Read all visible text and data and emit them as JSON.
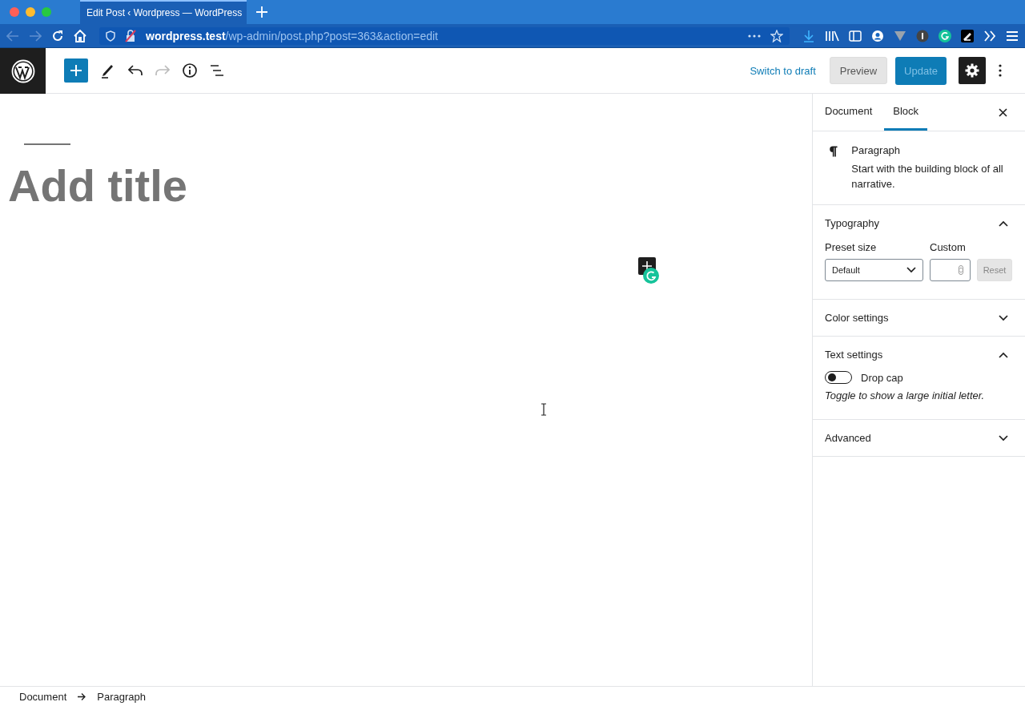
{
  "browser": {
    "tab": {
      "title": "Edit Post ‹ Wordpress — WordPress",
      "selected": true
    },
    "url_host": "wordpress.test",
    "url_path": "/wp-admin/post.php?post=363&action=edit"
  },
  "toolbar": {
    "tools": [
      {
        "kind": "inserter",
        "disabled": false
      },
      {
        "kind": "edit",
        "disabled": false
      },
      {
        "kind": "undo",
        "disabled": false
      },
      {
        "kind": "redo",
        "disabled": true
      },
      {
        "kind": "info",
        "disabled": false
      },
      {
        "kind": "outline",
        "disabled": false
      }
    ],
    "switch_label": "Switch to draft",
    "preview_label": "Preview",
    "update": {
      "label": "Update",
      "disabled": true
    },
    "settings_on": true
  },
  "editor": {
    "title_placeholder": "Add title"
  },
  "sidebar": {
    "tabs": [
      {
        "label": "Document",
        "selected": false
      },
      {
        "label": "Block",
        "selected": true
      }
    ],
    "block": {
      "name": "Paragraph",
      "description": "Start with the building block of all narrative."
    },
    "panels": [
      {
        "kind": "typography",
        "title": "Typography",
        "expanded": true,
        "preset_label": "Preset size",
        "preset_value": "Default",
        "custom_label": "Custom",
        "reset_label": "Reset"
      },
      {
        "title": "Color settings",
        "expanded": false
      },
      {
        "kind": "text",
        "title": "Text settings",
        "expanded": true,
        "toggle_label": "Drop cap",
        "on": false,
        "help": "Toggle to show a large initial letter."
      },
      {
        "title": "Advanced",
        "expanded": false
      }
    ]
  },
  "breadcrumb": [
    {
      "label": "Document"
    },
    {
      "label": "Paragraph"
    }
  ]
}
